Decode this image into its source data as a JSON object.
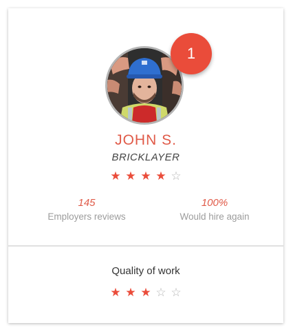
{
  "profile": {
    "name": "JOHN S.",
    "role": "BRICKLAYER",
    "rank": "1",
    "rating": 4,
    "rating_max": 5
  },
  "stats": [
    {
      "value": "145",
      "label": "Employers reviews"
    },
    {
      "value": "100%",
      "label": "Would hire again"
    }
  ],
  "quality": {
    "title": "Quality of work",
    "rating": 3,
    "rating_max": 5
  },
  "icons": {
    "star_filled": "★",
    "star_empty": "☆"
  },
  "colors": {
    "accent": "#ea4c3a",
    "name_text": "#e05a48",
    "muted_text": "#9c9c9c",
    "star_empty": "#b5b5b5"
  }
}
